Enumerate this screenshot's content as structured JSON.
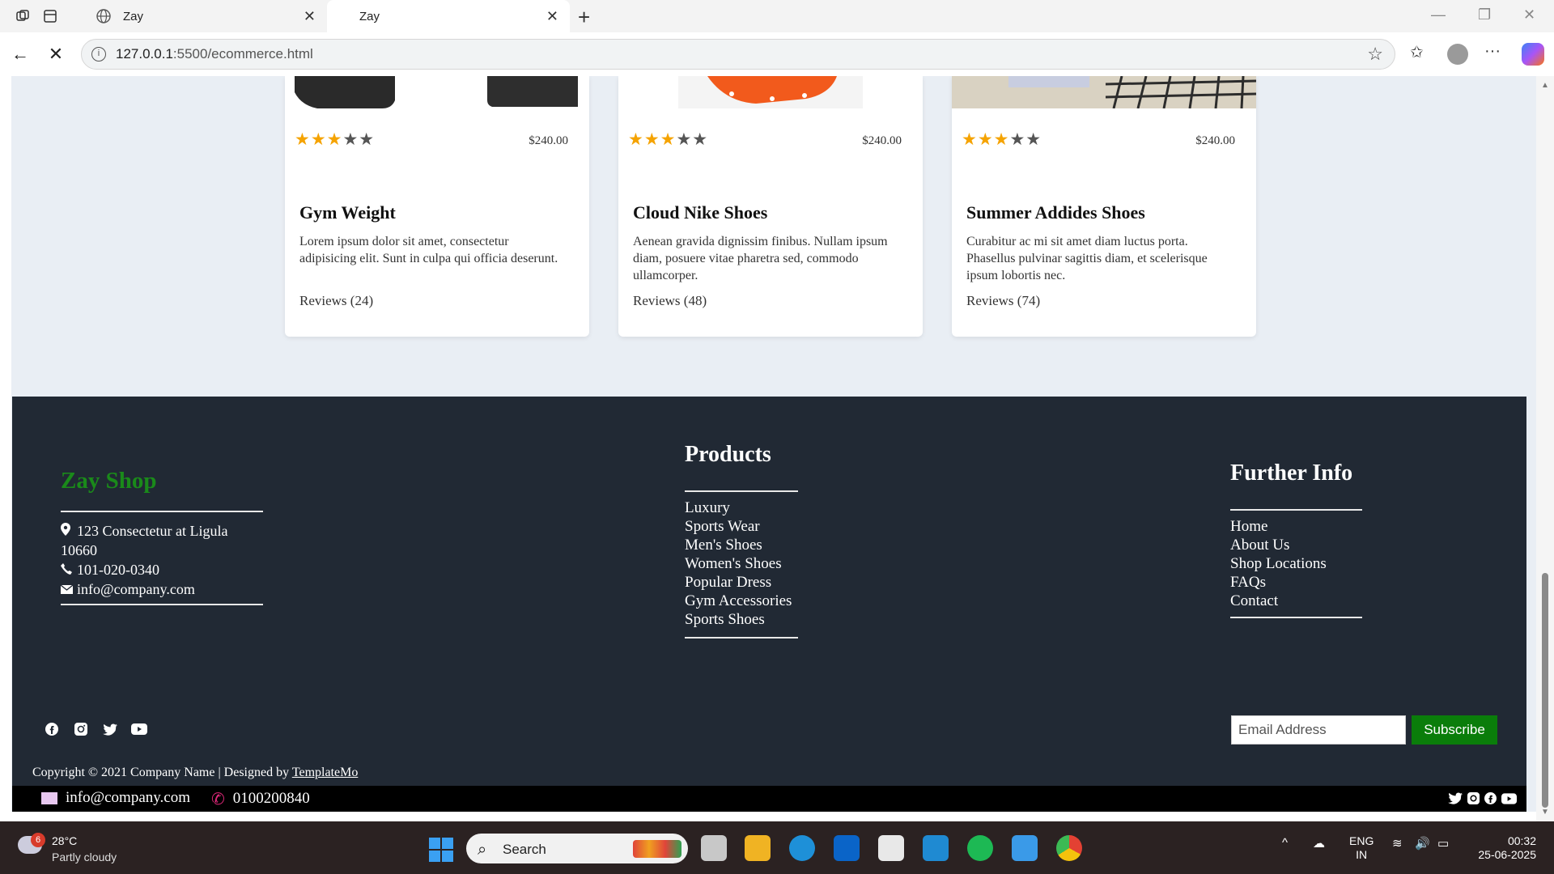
{
  "browser": {
    "tabs": [
      {
        "title": "Zay"
      },
      {
        "title": "Zay"
      }
    ],
    "url_host": "127.0.0.1",
    "url_rest": ":5500/ecommerce.html"
  },
  "products": [
    {
      "title": "Gym Weight",
      "price": "$240.00",
      "rating": 3,
      "description": "Lorem ipsum dolor sit amet, consectetur adipisicing elit. Sunt in culpa qui officia deserunt.",
      "reviews": "Reviews (24)"
    },
    {
      "title": "Cloud Nike Shoes",
      "price": "$240.00",
      "rating": 3,
      "description": "Aenean gravida dignissim finibus. Nullam ipsum diam, posuere vitae pharetra sed, commodo ullamcorper.",
      "reviews": "Reviews (48)"
    },
    {
      "title": "Summer Addides Shoes",
      "price": "$240.00",
      "rating": 3,
      "description": "Curabitur ac mi sit amet diam luctus porta. Phasellus pulvinar sagittis diam, et scelerisque ipsum lobortis nec.",
      "reviews": "Reviews (74)"
    }
  ],
  "footer": {
    "brand": "Zay Shop",
    "address": "123 Consectetur at Ligula 10660",
    "phone": "101-020-0340",
    "email": "info@company.com",
    "products_heading": "Products",
    "products_links": [
      "Luxury",
      "Sports Wear",
      "Men's Shoes",
      "Women's Shoes",
      "Popular Dress",
      "Gym Accessories",
      "Sports Shoes"
    ],
    "info_heading": "Further Info",
    "info_links": [
      "Home",
      "About Us",
      "Shop Locations",
      "FAQs",
      "Contact"
    ],
    "newsletter_placeholder": "Email Address",
    "subscribe_label": "Subscribe",
    "copyright_prefix": "Copyright © 2021 Company Name | Designed by ",
    "copyright_link": "TemplateMo"
  },
  "contact_bar": {
    "email": "info@company.com",
    "phone": "0100200840"
  },
  "taskbar": {
    "weather_badge": "6",
    "temperature": "28°C",
    "weather_desc": "Partly cloudy",
    "search_label": "Search",
    "lang_line1": "ENG",
    "lang_line2": "IN",
    "time": "00:32",
    "date": "25-06-2025"
  },
  "colors": {
    "brand_green": "#1a8a1a",
    "footer_bg": "#212934",
    "star_on": "#f5a300",
    "star_off": "#555555",
    "subscribe_bg": "#0a7d0a"
  }
}
